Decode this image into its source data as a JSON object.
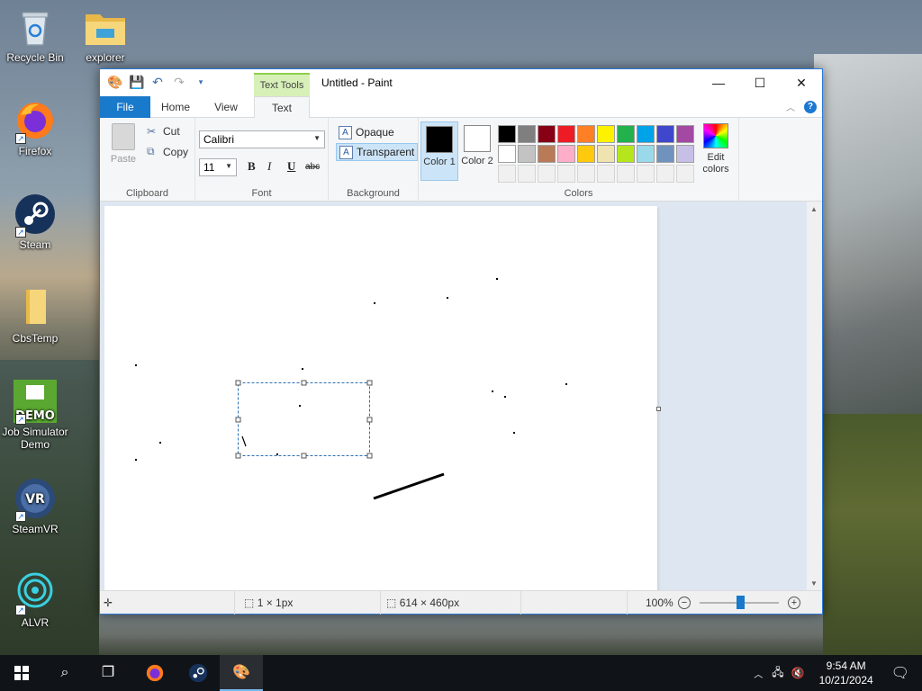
{
  "desktop": {
    "icons": [
      {
        "label": "Recycle Bin",
        "icon": "recycle-bin-icon"
      },
      {
        "label": "explorer",
        "icon": "folder-icon"
      },
      {
        "label": "Firefox",
        "icon": "firefox-icon"
      },
      {
        "label": "Steam",
        "icon": "steam-icon"
      },
      {
        "label": "CbsTemp",
        "icon": "folder-icon"
      },
      {
        "label": "Job Simulator Demo",
        "icon": "job-simulator-icon"
      },
      {
        "label": "SteamVR",
        "icon": "steamvr-icon"
      },
      {
        "label": "ALVR",
        "icon": "alvr-icon"
      }
    ]
  },
  "window": {
    "title": "Untitled - Paint",
    "context_tab": "Text Tools",
    "tabs": {
      "file": "File",
      "home": "Home",
      "view": "View",
      "text": "Text"
    },
    "help": "?"
  },
  "ribbon": {
    "clipboard": {
      "paste": "Paste",
      "cut": "Cut",
      "copy": "Copy",
      "label": "Clipboard"
    },
    "font": {
      "family": "Calibri",
      "size": "11",
      "bold": "B",
      "italic": "I",
      "underline": "U",
      "strike": "abc",
      "label": "Font"
    },
    "background": {
      "opaque": "Opaque",
      "transparent": "Transparent",
      "label": "Background"
    },
    "colors": {
      "color1_label": "Color 1",
      "color2_label": "Color 2",
      "color1": "#000000",
      "color2": "#ffffff",
      "edit_colors": "Edit colors",
      "label": "Colors",
      "palette_row1": [
        "#000000",
        "#7f7f7f",
        "#880015",
        "#ed1c24",
        "#ff7f27",
        "#fff200",
        "#22b14c",
        "#00a2e8",
        "#3f48cc",
        "#a349a4"
      ],
      "palette_row2": [
        "#ffffff",
        "#c3c3c3",
        "#b97a57",
        "#ffaec9",
        "#ffc90e",
        "#efe4b0",
        "#b5e61d",
        "#99d9ea",
        "#7092be",
        "#c8bfe7"
      ]
    }
  },
  "statusbar": {
    "selection_size": "1 × 1px",
    "canvas_size": "614 × 460px",
    "zoom": "100%"
  },
  "taskbar": {
    "time": "9:54 AM",
    "date": "10/21/2024"
  }
}
